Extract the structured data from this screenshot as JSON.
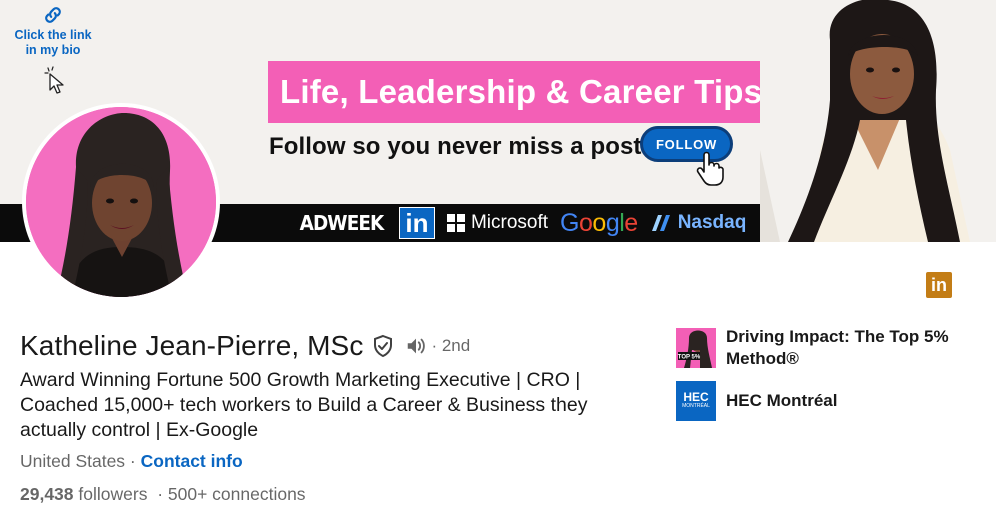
{
  "banner": {
    "link_hint": "Click the link in my bio",
    "headline": "Life, Leadership & Career Tips.",
    "follow_prompt": "Follow so you never miss a post",
    "follow_button": "FOLLOW",
    "logos": {
      "adweek": "ADWEEK",
      "linkedin": "in",
      "microsoft": "Microsoft",
      "google": "Google",
      "nasdaq": "Nasdaq"
    },
    "colors": {
      "pink": "#f35fb6",
      "strip": "#0b0b0b",
      "follow": "#0a66c2"
    }
  },
  "profile": {
    "name": "Katheline Jean-Pierre, MSc",
    "degree": "· 2nd",
    "headline": "Award Winning Fortune 500 Growth Marketing Executive | CRO | Coached 15,000+ tech workers to Build a Career & Business they actually control | Ex-Google",
    "location": "United States",
    "location_sep": " · ",
    "contact_info": "Contact info",
    "followers_count": "29,438",
    "followers_label": " followers",
    "connections": "· 500+ connections"
  },
  "sidebar": {
    "linkedin_badge": "in",
    "affiliations": [
      {
        "label": "Driving Impact: The Top 5% Method®",
        "logo_text": "TOP 5%"
      },
      {
        "label": "HEC Montréal",
        "logo_text_1": "HEC",
        "logo_text_2": "MONTRÉAL"
      }
    ]
  },
  "icons": {
    "link": "link-icon",
    "cursor": "pointer-click-icon",
    "hand": "hand-cursor-icon",
    "verified": "verified-shield-icon",
    "speaker": "speaker-icon"
  }
}
